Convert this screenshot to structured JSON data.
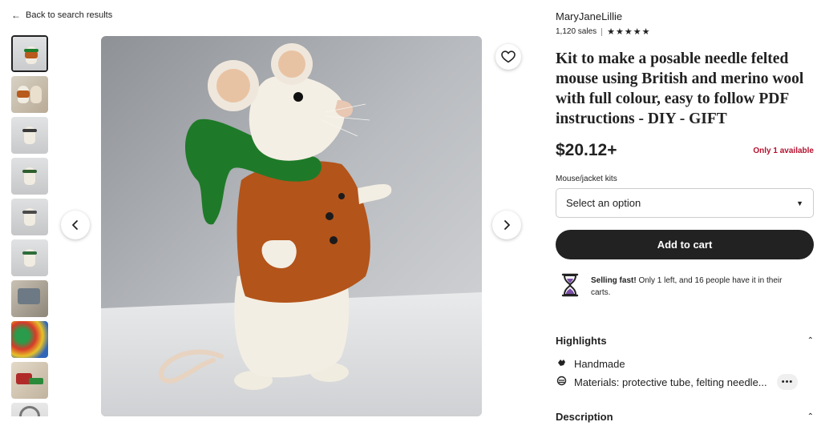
{
  "nav": {
    "back_label": "Back to search results"
  },
  "shop": {
    "name": "MaryJaneLillie",
    "sales": "1,120 sales",
    "stars": "★★★★★",
    "rating": 5
  },
  "listing": {
    "title": "Kit to make a posable needle felted mouse using British and merino wool with full colour, easy to follow PDF instructions - DIY - GIFT",
    "price": "$20.12+",
    "availability": "Only 1 available"
  },
  "variation": {
    "label": "Mouse/jacket kits",
    "placeholder": "Select an option"
  },
  "cart": {
    "button_label": "Add to cart"
  },
  "selling_fast": {
    "bold": "Selling fast!",
    "text": " Only 1 left, and 16 people have it in their carts."
  },
  "highlights": {
    "heading": "Highlights",
    "items": [
      {
        "icon": "hand-icon",
        "label": "Handmade"
      },
      {
        "icon": "materials-icon",
        "label": "Materials: protective tube, felting needle..."
      }
    ],
    "more_label": "•••"
  },
  "description": {
    "heading": "Description"
  },
  "gallery": {
    "thumbnail_count": 10,
    "active_index": 0
  },
  "colors": {
    "button_dark": "#222222",
    "alert_red": "#b3112e",
    "accent_purple": "#7b4fa8"
  }
}
